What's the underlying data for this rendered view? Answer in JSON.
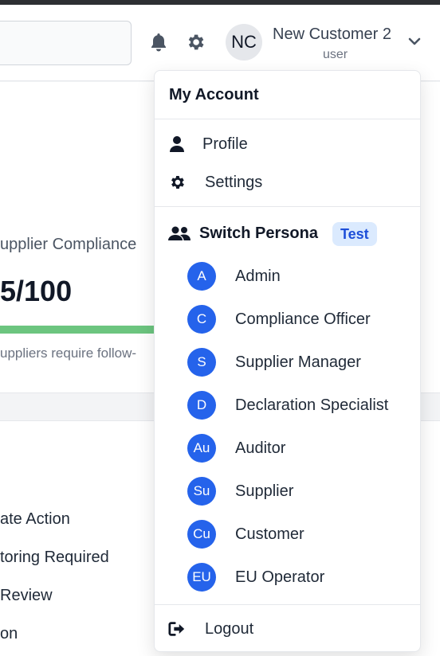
{
  "header": {
    "user_initials": "NC",
    "user_name": "New Customer 2",
    "user_role": "user"
  },
  "background": {
    "card_title": "upplier Compliance",
    "score": "5/100",
    "note": "uppliers require follow-",
    "list_items": [
      "ate Action",
      "toring Required",
      "Review",
      "on"
    ]
  },
  "dropdown": {
    "title": "My Account",
    "items": [
      {
        "label": "Profile",
        "icon": "user-icon"
      },
      {
        "label": "Settings",
        "icon": "gear-icon"
      }
    ],
    "switch_persona": {
      "label": "Switch Persona",
      "badge": "Test",
      "icon": "users-icon"
    },
    "personas": [
      {
        "initials": "A",
        "label": "Admin"
      },
      {
        "initials": "C",
        "label": "Compliance Officer"
      },
      {
        "initials": "S",
        "label": "Supplier Manager"
      },
      {
        "initials": "D",
        "label": "Declaration Specialist"
      },
      {
        "initials": "Au",
        "label": "Auditor"
      },
      {
        "initials": "Su",
        "label": "Supplier"
      },
      {
        "initials": "Cu",
        "label": "Customer"
      },
      {
        "initials": "EU",
        "label": "EU Operator"
      }
    ],
    "logout": {
      "label": "Logout",
      "icon": "sign-out-icon"
    }
  },
  "colors": {
    "accent": "#2563eb",
    "badge_bg": "#dbeafe",
    "progress": "#6cc57f"
  }
}
